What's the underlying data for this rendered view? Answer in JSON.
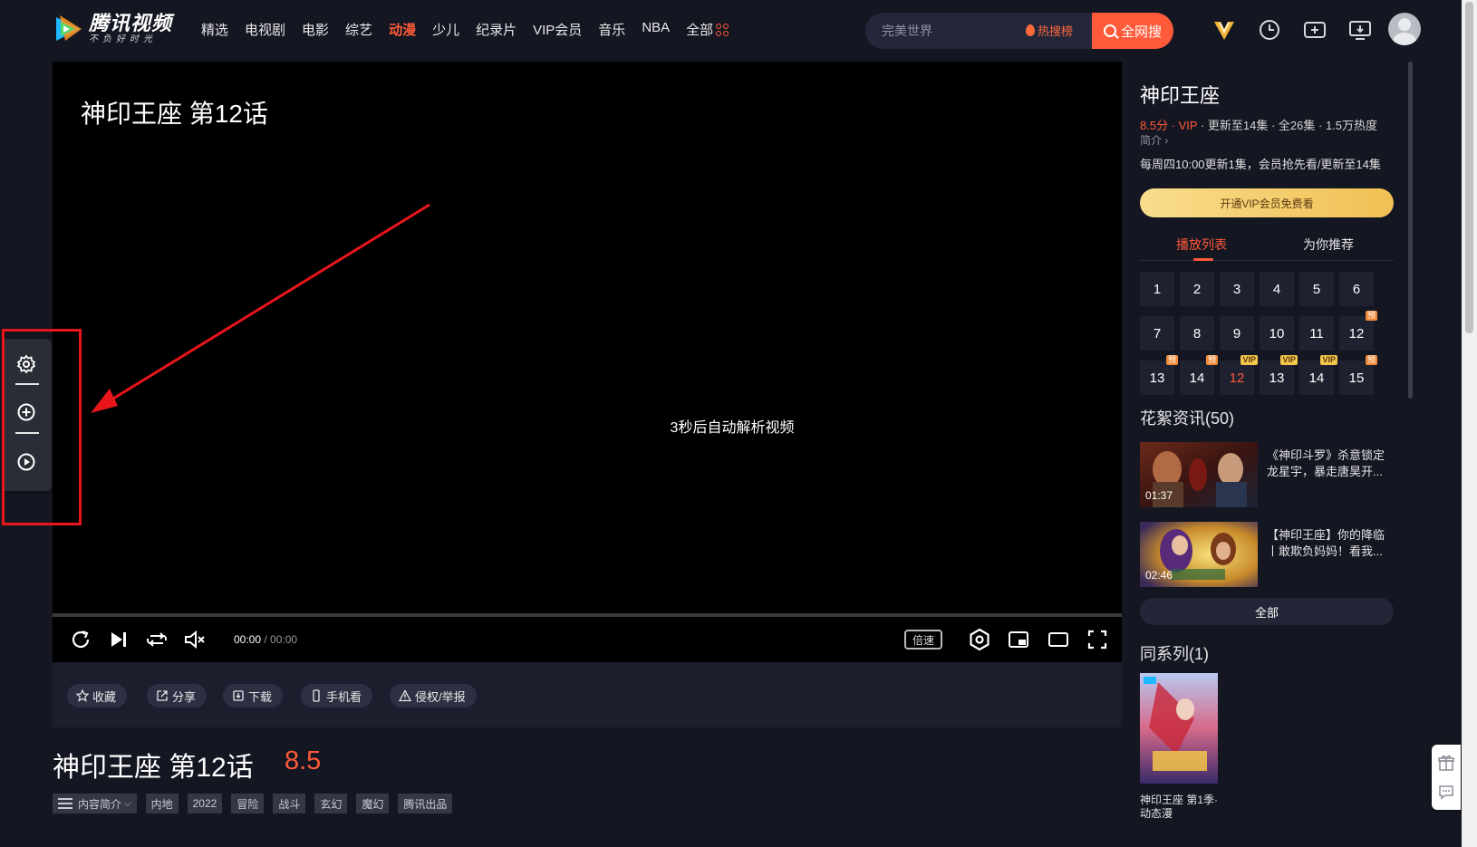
{
  "header": {
    "logo_title": "腾讯视频",
    "logo_slogan": "不负好时光",
    "nav": [
      "精选",
      "电视剧",
      "电影",
      "综艺",
      "动漫",
      "少儿",
      "纪录片",
      "VIP会员",
      "音乐",
      "NBA"
    ],
    "nav_active": "动漫",
    "nav_all": "全部",
    "search_placeholder": "完美世界",
    "hot_label": "热搜榜",
    "search_button": "全网搜"
  },
  "player": {
    "title": "神印王座 第12话",
    "status_message": "3秒后自动解析视频",
    "time_current": "00:00",
    "time_total": "00:00",
    "speed_label": "倍速"
  },
  "actions": [
    "收藏",
    "分享",
    "下载",
    "手机看",
    "侵权/举报"
  ],
  "info": {
    "title": "神印王座 第12话",
    "score": "8.5",
    "intro_label": "内容简介",
    "tags": [
      "内地",
      "2022",
      "冒险",
      "战斗",
      "玄幻",
      "魔幻",
      "腾讯出品"
    ]
  },
  "panel": {
    "title": "神印王座",
    "score": "8.5分",
    "vip": "VIP",
    "meta_rest": " · 更新至14集 · 全26集 · 1.5万热度",
    "intro_link": "简介",
    "update_note": "每周四10:00更新1集，会员抢先看/更新至14集",
    "vip_button": "开通VIP会员免费看",
    "tabs": [
      "播放列表",
      "为你推荐"
    ],
    "episodes": [
      {
        "n": "1"
      },
      {
        "n": "2"
      },
      {
        "n": "3"
      },
      {
        "n": "4"
      },
      {
        "n": "5"
      },
      {
        "n": "6"
      },
      {
        "n": "7"
      },
      {
        "n": "8"
      },
      {
        "n": "9"
      },
      {
        "n": "10"
      },
      {
        "n": "11"
      },
      {
        "n": "12",
        "badge": "预"
      },
      {
        "n": "13",
        "badge": "预"
      },
      {
        "n": "14",
        "badge": "预"
      },
      {
        "n": "12",
        "badge": "VIP",
        "current": true
      },
      {
        "n": "13",
        "badge": "VIP"
      },
      {
        "n": "14",
        "badge": "VIP"
      },
      {
        "n": "15",
        "badge": "预"
      }
    ],
    "clips_title": "花絮资讯(50)",
    "clips": [
      {
        "duration": "01:37",
        "text": "《神印斗罗》杀意锁定龙星宇，暴走唐昊开..."
      },
      {
        "duration": "02:46",
        "text": "【神印王座】你的降临丨敢欺负妈妈！看我..."
      }
    ],
    "all_button": "全部",
    "series_title": "同系列(1)",
    "series_name": "神印王座 第1季·动态漫"
  },
  "colors": {
    "accent": "#ff5a3a",
    "background": "#141622",
    "annotation_red": "#e8151b"
  }
}
